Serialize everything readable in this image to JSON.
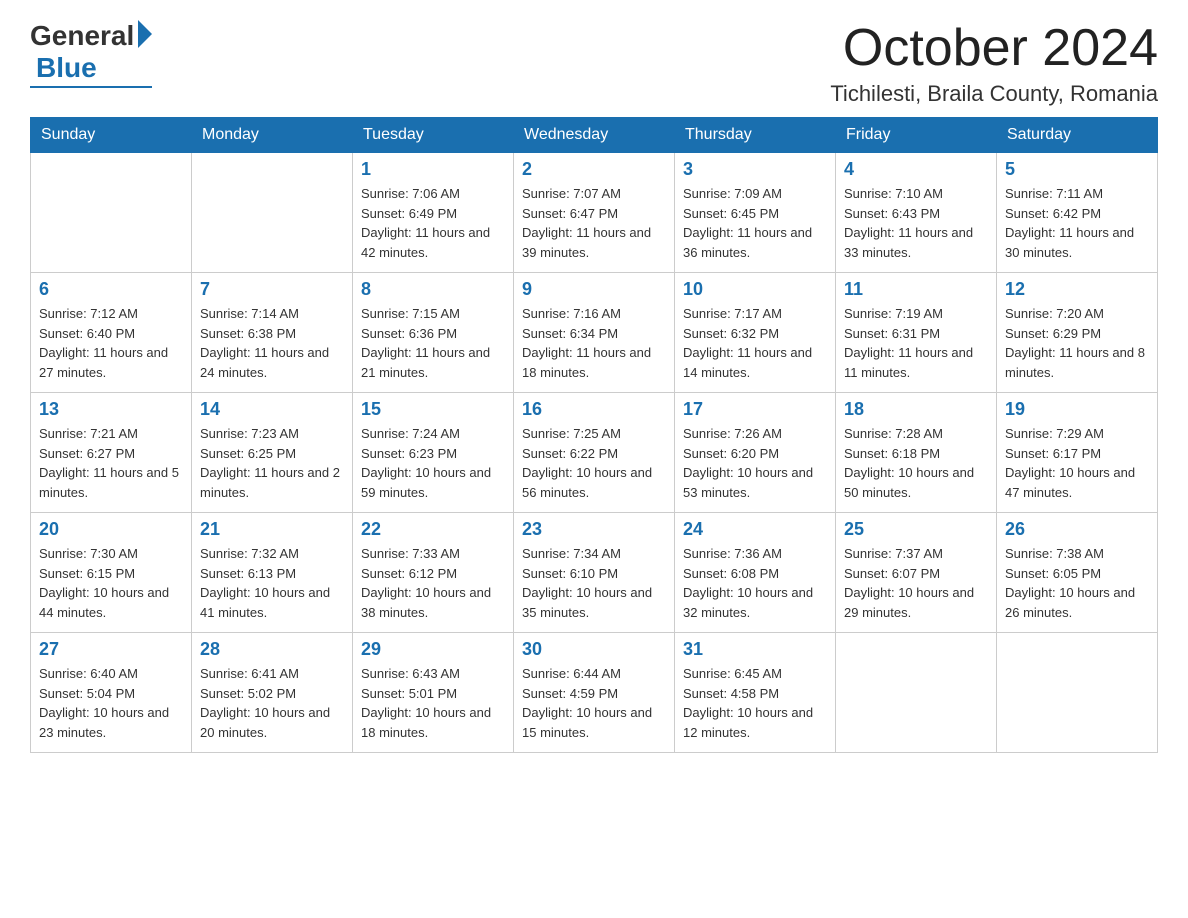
{
  "header": {
    "logo_general": "General",
    "logo_blue": "Blue",
    "month_title": "October 2024",
    "location": "Tichilesti, Braila County, Romania"
  },
  "days_of_week": [
    "Sunday",
    "Monday",
    "Tuesday",
    "Wednesday",
    "Thursday",
    "Friday",
    "Saturday"
  ],
  "weeks": [
    [
      {
        "day": "",
        "sunrise": "",
        "sunset": "",
        "daylight": ""
      },
      {
        "day": "",
        "sunrise": "",
        "sunset": "",
        "daylight": ""
      },
      {
        "day": "1",
        "sunrise": "Sunrise: 7:06 AM",
        "sunset": "Sunset: 6:49 PM",
        "daylight": "Daylight: 11 hours and 42 minutes."
      },
      {
        "day": "2",
        "sunrise": "Sunrise: 7:07 AM",
        "sunset": "Sunset: 6:47 PM",
        "daylight": "Daylight: 11 hours and 39 minutes."
      },
      {
        "day": "3",
        "sunrise": "Sunrise: 7:09 AM",
        "sunset": "Sunset: 6:45 PM",
        "daylight": "Daylight: 11 hours and 36 minutes."
      },
      {
        "day": "4",
        "sunrise": "Sunrise: 7:10 AM",
        "sunset": "Sunset: 6:43 PM",
        "daylight": "Daylight: 11 hours and 33 minutes."
      },
      {
        "day": "5",
        "sunrise": "Sunrise: 7:11 AM",
        "sunset": "Sunset: 6:42 PM",
        "daylight": "Daylight: 11 hours and 30 minutes."
      }
    ],
    [
      {
        "day": "6",
        "sunrise": "Sunrise: 7:12 AM",
        "sunset": "Sunset: 6:40 PM",
        "daylight": "Daylight: 11 hours and 27 minutes."
      },
      {
        "day": "7",
        "sunrise": "Sunrise: 7:14 AM",
        "sunset": "Sunset: 6:38 PM",
        "daylight": "Daylight: 11 hours and 24 minutes."
      },
      {
        "day": "8",
        "sunrise": "Sunrise: 7:15 AM",
        "sunset": "Sunset: 6:36 PM",
        "daylight": "Daylight: 11 hours and 21 minutes."
      },
      {
        "day": "9",
        "sunrise": "Sunrise: 7:16 AM",
        "sunset": "Sunset: 6:34 PM",
        "daylight": "Daylight: 11 hours and 18 minutes."
      },
      {
        "day": "10",
        "sunrise": "Sunrise: 7:17 AM",
        "sunset": "Sunset: 6:32 PM",
        "daylight": "Daylight: 11 hours and 14 minutes."
      },
      {
        "day": "11",
        "sunrise": "Sunrise: 7:19 AM",
        "sunset": "Sunset: 6:31 PM",
        "daylight": "Daylight: 11 hours and 11 minutes."
      },
      {
        "day": "12",
        "sunrise": "Sunrise: 7:20 AM",
        "sunset": "Sunset: 6:29 PM",
        "daylight": "Daylight: 11 hours and 8 minutes."
      }
    ],
    [
      {
        "day": "13",
        "sunrise": "Sunrise: 7:21 AM",
        "sunset": "Sunset: 6:27 PM",
        "daylight": "Daylight: 11 hours and 5 minutes."
      },
      {
        "day": "14",
        "sunrise": "Sunrise: 7:23 AM",
        "sunset": "Sunset: 6:25 PM",
        "daylight": "Daylight: 11 hours and 2 minutes."
      },
      {
        "day": "15",
        "sunrise": "Sunrise: 7:24 AM",
        "sunset": "Sunset: 6:23 PM",
        "daylight": "Daylight: 10 hours and 59 minutes."
      },
      {
        "day": "16",
        "sunrise": "Sunrise: 7:25 AM",
        "sunset": "Sunset: 6:22 PM",
        "daylight": "Daylight: 10 hours and 56 minutes."
      },
      {
        "day": "17",
        "sunrise": "Sunrise: 7:26 AM",
        "sunset": "Sunset: 6:20 PM",
        "daylight": "Daylight: 10 hours and 53 minutes."
      },
      {
        "day": "18",
        "sunrise": "Sunrise: 7:28 AM",
        "sunset": "Sunset: 6:18 PM",
        "daylight": "Daylight: 10 hours and 50 minutes."
      },
      {
        "day": "19",
        "sunrise": "Sunrise: 7:29 AM",
        "sunset": "Sunset: 6:17 PM",
        "daylight": "Daylight: 10 hours and 47 minutes."
      }
    ],
    [
      {
        "day": "20",
        "sunrise": "Sunrise: 7:30 AM",
        "sunset": "Sunset: 6:15 PM",
        "daylight": "Daylight: 10 hours and 44 minutes."
      },
      {
        "day": "21",
        "sunrise": "Sunrise: 7:32 AM",
        "sunset": "Sunset: 6:13 PM",
        "daylight": "Daylight: 10 hours and 41 minutes."
      },
      {
        "day": "22",
        "sunrise": "Sunrise: 7:33 AM",
        "sunset": "Sunset: 6:12 PM",
        "daylight": "Daylight: 10 hours and 38 minutes."
      },
      {
        "day": "23",
        "sunrise": "Sunrise: 7:34 AM",
        "sunset": "Sunset: 6:10 PM",
        "daylight": "Daylight: 10 hours and 35 minutes."
      },
      {
        "day": "24",
        "sunrise": "Sunrise: 7:36 AM",
        "sunset": "Sunset: 6:08 PM",
        "daylight": "Daylight: 10 hours and 32 minutes."
      },
      {
        "day": "25",
        "sunrise": "Sunrise: 7:37 AM",
        "sunset": "Sunset: 6:07 PM",
        "daylight": "Daylight: 10 hours and 29 minutes."
      },
      {
        "day": "26",
        "sunrise": "Sunrise: 7:38 AM",
        "sunset": "Sunset: 6:05 PM",
        "daylight": "Daylight: 10 hours and 26 minutes."
      }
    ],
    [
      {
        "day": "27",
        "sunrise": "Sunrise: 6:40 AM",
        "sunset": "Sunset: 5:04 PM",
        "daylight": "Daylight: 10 hours and 23 minutes."
      },
      {
        "day": "28",
        "sunrise": "Sunrise: 6:41 AM",
        "sunset": "Sunset: 5:02 PM",
        "daylight": "Daylight: 10 hours and 20 minutes."
      },
      {
        "day": "29",
        "sunrise": "Sunrise: 6:43 AM",
        "sunset": "Sunset: 5:01 PM",
        "daylight": "Daylight: 10 hours and 18 minutes."
      },
      {
        "day": "30",
        "sunrise": "Sunrise: 6:44 AM",
        "sunset": "Sunset: 4:59 PM",
        "daylight": "Daylight: 10 hours and 15 minutes."
      },
      {
        "day": "31",
        "sunrise": "Sunrise: 6:45 AM",
        "sunset": "Sunset: 4:58 PM",
        "daylight": "Daylight: 10 hours and 12 minutes."
      },
      {
        "day": "",
        "sunrise": "",
        "sunset": "",
        "daylight": ""
      },
      {
        "day": "",
        "sunrise": "",
        "sunset": "",
        "daylight": ""
      }
    ]
  ]
}
